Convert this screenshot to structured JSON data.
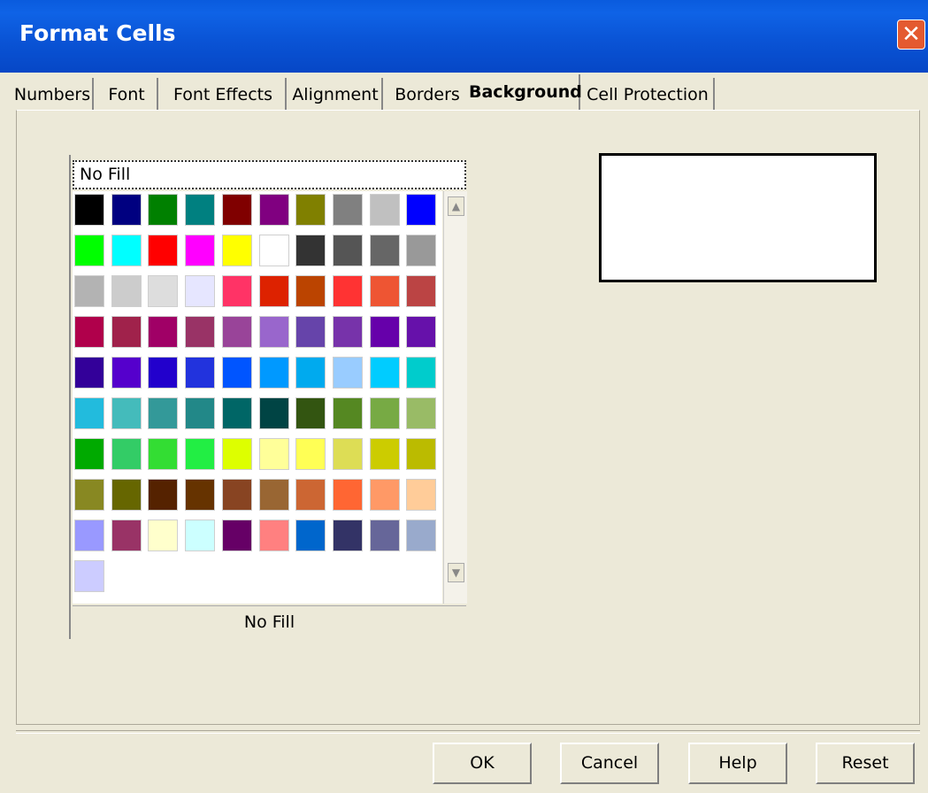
{
  "window": {
    "title": "Format Cells",
    "close_label": "✕"
  },
  "tabs": [
    "Numbers",
    "Font",
    "Font Effects",
    "Alignment",
    "Borders",
    "Background",
    "Cell Protection"
  ],
  "active_tab": "Background",
  "palette": {
    "top_label": "No Fill",
    "bottom_label": "No Fill",
    "swatches": [
      "#000000",
      "#000080",
      "#008000",
      "#008080",
      "#800000",
      "#800080",
      "#808000",
      "#808080",
      "#c0c0c0",
      "#0000ff",
      "#00ff00",
      "#00ffff",
      "#ff0000",
      "#ff00ff",
      "#ffff00",
      "#ffffff",
      "#333333",
      "#555555",
      "#666666",
      "#999999",
      "#b3b3b3",
      "#cccccc",
      "#dddddd",
      "#e6e6ff",
      "#ff3366",
      "#dd2200",
      "#bb4400",
      "#ff3333",
      "#ee5533",
      "#bb4444",
      "#b0004b",
      "#a0224b",
      "#a00066",
      "#993366",
      "#994499",
      "#9966cc",
      "#6644aa",
      "#7733aa",
      "#6600aa",
      "#6611aa",
      "#330099",
      "#5500cc",
      "#2200cc",
      "#2233dd",
      "#0055ff",
      "#0099ff",
      "#00aaee",
      "#99ccff",
      "#00ccff",
      "#00cccc",
      "#22bbdd",
      "#44bbbb",
      "#339999",
      "#228888",
      "#006666",
      "#004444",
      "#335511",
      "#558822",
      "#77aa44",
      "#99bb66",
      "#00aa00",
      "#33cc66",
      "#33dd33",
      "#22ee44",
      "#ddff00",
      "#ffff99",
      "#ffff55",
      "#dddd55",
      "#cccc00",
      "#bbbb00",
      "#888822",
      "#666600",
      "#552200",
      "#663300",
      "#884422",
      "#996633",
      "#cc6633",
      "#ff6633",
      "#ff9966",
      "#ffcc99",
      "#9999ff",
      "#993366",
      "#ffffcc",
      "#ccffff",
      "#660066",
      "#ff8080",
      "#0066cc",
      "#333366",
      "#666699",
      "#99aacc",
      "#ccccff"
    ],
    "scroll_up": "▲",
    "scroll_down": "▼"
  },
  "buttons": {
    "ok": "OK",
    "cancel": "Cancel",
    "help": "Help",
    "reset": "Reset"
  }
}
